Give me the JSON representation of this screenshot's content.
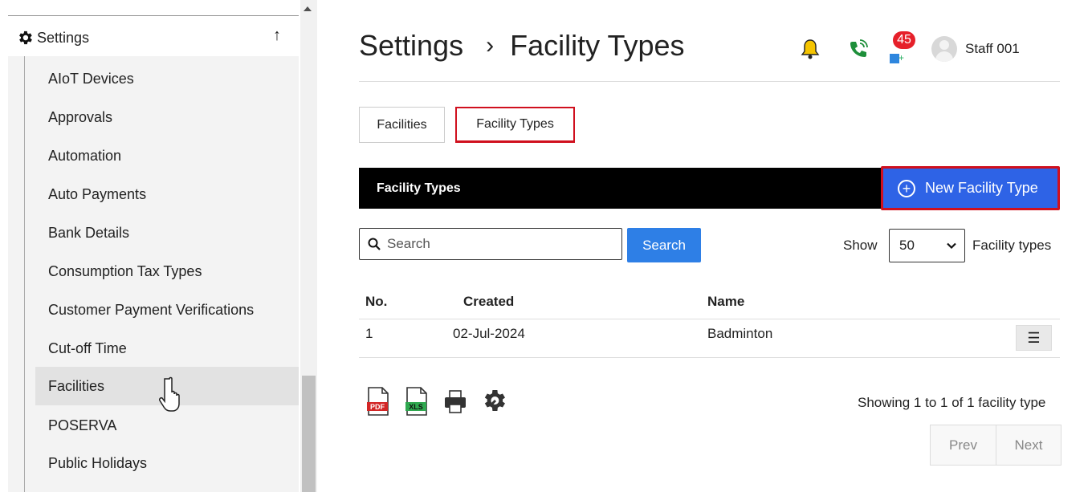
{
  "sidebar": {
    "section_label": "Settings",
    "section_icon": "gear-icon",
    "collapse_icon": "arrow-up-icon",
    "items": [
      {
        "label": "AIoT Devices"
      },
      {
        "label": "Approvals"
      },
      {
        "label": "Automation"
      },
      {
        "label": "Auto Payments"
      },
      {
        "label": "Bank Details"
      },
      {
        "label": "Consumption Tax Types"
      },
      {
        "label": "Customer Payment Verifications"
      },
      {
        "label": "Cut-off Time"
      },
      {
        "label": "Facilities"
      },
      {
        "label": "POSERVA"
      },
      {
        "label": "Public Holidays"
      }
    ],
    "active_item": "Facilities"
  },
  "header": {
    "breadcrumb_root": "Settings",
    "breadcrumb_separator": "›",
    "breadcrumb_current": "Facility Types",
    "notification_count": "45",
    "user_name": "Staff 001"
  },
  "tabs": [
    {
      "label": "Facilities",
      "active": false
    },
    {
      "label": "Facility Types",
      "active": true
    }
  ],
  "panel": {
    "title": "Facility Types",
    "new_button_label": "New Facility Type"
  },
  "filters": {
    "search_placeholder": "Search",
    "search_button_label": "Search",
    "show_label": "Show",
    "page_size": "50",
    "show_suffix": "Facility types"
  },
  "table": {
    "columns": [
      "No.",
      "Created",
      "Name"
    ],
    "rows": [
      {
        "no": "1",
        "created": "02-Jul-2024",
        "name": "Badminton",
        "menu": "☰"
      }
    ]
  },
  "footer": {
    "export_icons": [
      "pdf-icon",
      "xls-icon",
      "print-icon",
      "settings-wrench-icon"
    ],
    "pdf_label": "PDF",
    "xls_label": "XLS",
    "showing_text": "Showing 1 to 1 of 1 facility type",
    "prev_label": "Prev",
    "next_label": "Next"
  },
  "colors": {
    "primary_blue": "#2e63e6",
    "search_blue": "#2e7fe6",
    "highlight_red": "#d0101e",
    "badge_red": "#e6202a",
    "bell_yellow": "#f5c400",
    "phone_green": "#1e8f3a"
  }
}
